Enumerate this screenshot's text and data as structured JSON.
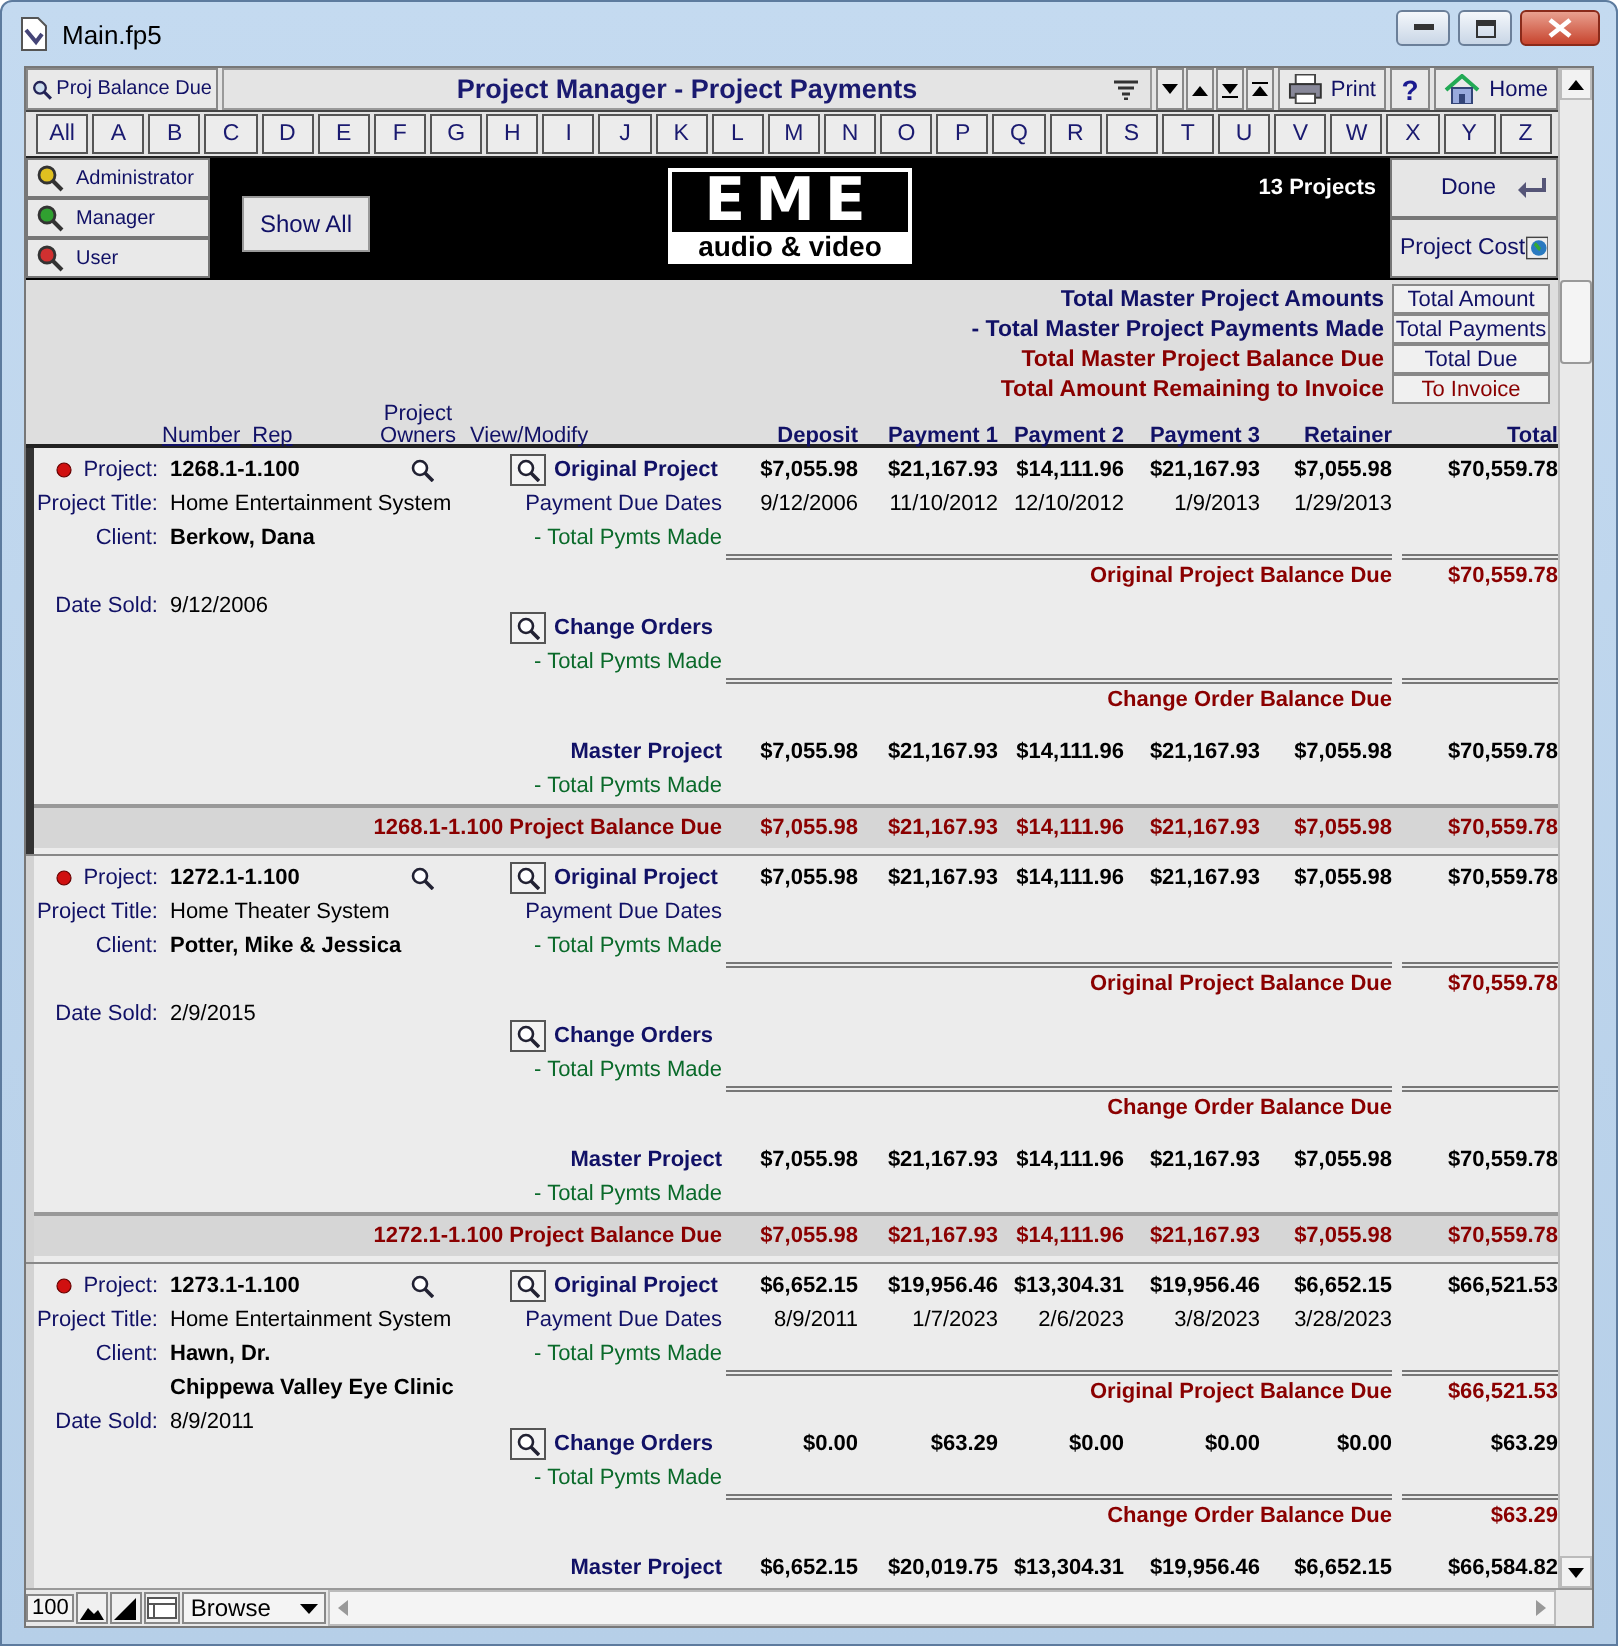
{
  "window": {
    "title": "Main.fp5"
  },
  "toolbar": {
    "balance_button": "Proj Balance Due",
    "title": "Project Manager - Project Payments",
    "print": "Print",
    "help": "?",
    "home": "Home"
  },
  "letters": [
    "All",
    "A",
    "B",
    "C",
    "D",
    "E",
    "F",
    "G",
    "H",
    "I",
    "J",
    "K",
    "L",
    "M",
    "N",
    "O",
    "P",
    "Q",
    "R",
    "S",
    "T",
    "U",
    "V",
    "W",
    "X",
    "Y",
    "Z"
  ],
  "roles": [
    {
      "label": "Administrator",
      "color": "#e0c020"
    },
    {
      "label": "Manager",
      "color": "#30a030"
    },
    {
      "label": "User",
      "color": "#d03030"
    }
  ],
  "show_all": "Show All",
  "logo": {
    "mark": "EME",
    "tagline": "audio & video"
  },
  "project_count": "13 Projects",
  "done": "Done",
  "project_cost": "Project Cost",
  "summary": [
    {
      "label": "Total Master Project Amounts",
      "button": "Total Amount",
      "kind": "total"
    },
    {
      "label": "- Total Master Project Payments Made",
      "button": "Total Payments",
      "kind": "total"
    },
    {
      "label": "Total Master Project Balance Due",
      "button": "Total Due",
      "kind": "due"
    },
    {
      "label": "Total Amount Remaining to Invoice",
      "button": "To Invoice",
      "kind": "invoice"
    }
  ],
  "columns": {
    "number": "Number",
    "rep": "Rep",
    "owners": "Project Owners",
    "view": "View/Modify",
    "amounts": [
      "Deposit",
      "Payment 1",
      "Payment 2",
      "Payment 3",
      "Retainer",
      "Total"
    ]
  },
  "records": [
    {
      "selected": true,
      "project_label": "Project:",
      "project": "1268.1-1.100",
      "title_label": "Project Title:",
      "title": "Home Entertainment System",
      "client_label": "Client:",
      "client": [
        "Berkow, Dana"
      ],
      "date_label": "Date Sold:",
      "date_sold": "9/12/2006",
      "original": {
        "label": "Original Project",
        "amounts": [
          "$7,055.98",
          "$21,167.93",
          "$14,111.96",
          "$21,167.93",
          "$7,055.98",
          "$70,559.78"
        ],
        "dates_label": "Payment Due Dates",
        "dates": [
          "9/12/2006",
          "11/10/2012",
          "12/10/2012",
          "1/9/2013",
          "1/29/2013"
        ],
        "paid_label": "- Total Pymts Made",
        "balance_label": "Original Project Balance Due",
        "balance": "$70,559.78"
      },
      "change": {
        "label": "Change Orders",
        "paid_label": "- Total Pymts Made",
        "balance_label": "Change Order Balance Due"
      },
      "master": {
        "label": "Master Project",
        "amounts": [
          "$7,055.98",
          "$21,167.93",
          "$14,111.96",
          "$21,167.93",
          "$7,055.98",
          "$70,559.78"
        ],
        "paid_label": "- Total Pymts Made"
      },
      "due": {
        "label": "1268.1-1.100 Project Balance Due",
        "amounts": [
          "$7,055.98",
          "$21,167.93",
          "$14,111.96",
          "$21,167.93",
          "$7,055.98",
          "$70,559.78"
        ]
      }
    },
    {
      "selected": false,
      "project_label": "Project:",
      "project": "1272.1-1.100",
      "title_label": "Project Title:",
      "title": "Home Theater System",
      "client_label": "Client:",
      "client": [
        "Potter, Mike & Jessica"
      ],
      "date_label": "Date Sold:",
      "date_sold": "2/9/2015",
      "original": {
        "label": "Original Project",
        "amounts": [
          "$7,055.98",
          "$21,167.93",
          "$14,111.96",
          "$21,167.93",
          "$7,055.98",
          "$70,559.78"
        ],
        "dates_label": "Payment Due Dates",
        "paid_label": "- Total Pymts Made",
        "balance_label": "Original Project Balance Due",
        "balance": "$70,559.78"
      },
      "change": {
        "label": "Change Orders",
        "paid_label": "- Total Pymts Made",
        "balance_label": "Change Order Balance Due"
      },
      "master": {
        "label": "Master Project",
        "amounts": [
          "$7,055.98",
          "$21,167.93",
          "$14,111.96",
          "$21,167.93",
          "$7,055.98",
          "$70,559.78"
        ],
        "paid_label": "- Total Pymts Made"
      },
      "due": {
        "label": "1272.1-1.100 Project Balance Due",
        "amounts": [
          "$7,055.98",
          "$21,167.93",
          "$14,111.96",
          "$21,167.93",
          "$7,055.98",
          "$70,559.78"
        ]
      }
    },
    {
      "selected": false,
      "project_label": "Project:",
      "project": "1273.1-1.100",
      "title_label": "Project Title:",
      "title": "Home Entertainment System",
      "client_label": "Client:",
      "client": [
        "Hawn, Dr.",
        "Chippewa Valley Eye Clinic"
      ],
      "date_label": "Date Sold:",
      "date_sold": "8/9/2011",
      "original": {
        "label": "Original Project",
        "amounts": [
          "$6,652.15",
          "$19,956.46",
          "$13,304.31",
          "$19,956.46",
          "$6,652.15",
          "$66,521.53"
        ],
        "dates_label": "Payment Due Dates",
        "dates": [
          "8/9/2011",
          "1/7/2023",
          "2/6/2023",
          "3/8/2023",
          "3/28/2023"
        ],
        "paid_label": "- Total Pymts Made",
        "balance_label": "Original Project Balance Due",
        "balance": "$66,521.53"
      },
      "change": {
        "label": "Change Orders",
        "amounts": [
          "$0.00",
          "$63.29",
          "$0.00",
          "$0.00",
          "$0.00",
          "$63.29"
        ],
        "paid_label": "- Total Pymts Made",
        "balance_label": "Change Order Balance Due",
        "balance": "$63.29"
      },
      "master": {
        "label": "Master Project",
        "amounts": [
          "$6,652.15",
          "$20,019.75",
          "$13,304.31",
          "$19,956.46",
          "$6,652.15",
          "$66,584.82"
        ]
      }
    }
  ],
  "status_bar": {
    "zoom": "100",
    "mode": "Browse"
  }
}
